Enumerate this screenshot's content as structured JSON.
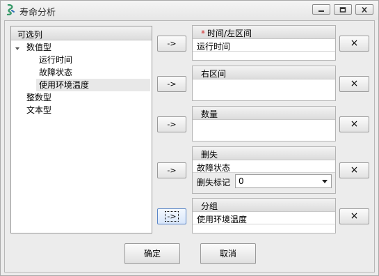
{
  "window": {
    "title": "寿命分析",
    "icon": "app-logo-icon",
    "controls": [
      "minimize-icon",
      "maximize-icon",
      "close-icon"
    ]
  },
  "variables": {
    "header": "可选列",
    "groups": [
      {
        "label": "数值型",
        "expanded": true,
        "children": [
          "运行时间",
          "故障状态",
          "使用环境温度"
        ],
        "selected_child": "使用环境温度"
      },
      {
        "label": "整数型"
      },
      {
        "label": "文本型"
      }
    ]
  },
  "move_button_label": "->",
  "remove_button_label": "×",
  "slots": {
    "time_left": {
      "required_mark": "*",
      "label": "时间/左区间",
      "value": "运行时间"
    },
    "right_interval": {
      "label": "右区间",
      "value": ""
    },
    "quantity": {
      "label": "数量",
      "value": ""
    },
    "censor": {
      "label": "删失",
      "value": "故障状态",
      "flag_label": "删失标记",
      "flag_value": "0"
    },
    "group": {
      "label": "分组",
      "value": "使用环境温度"
    }
  },
  "buttons": {
    "ok": "确定",
    "cancel": "取消"
  },
  "colors": {
    "required": "#d03030",
    "focus_border": "#5a86c8"
  }
}
